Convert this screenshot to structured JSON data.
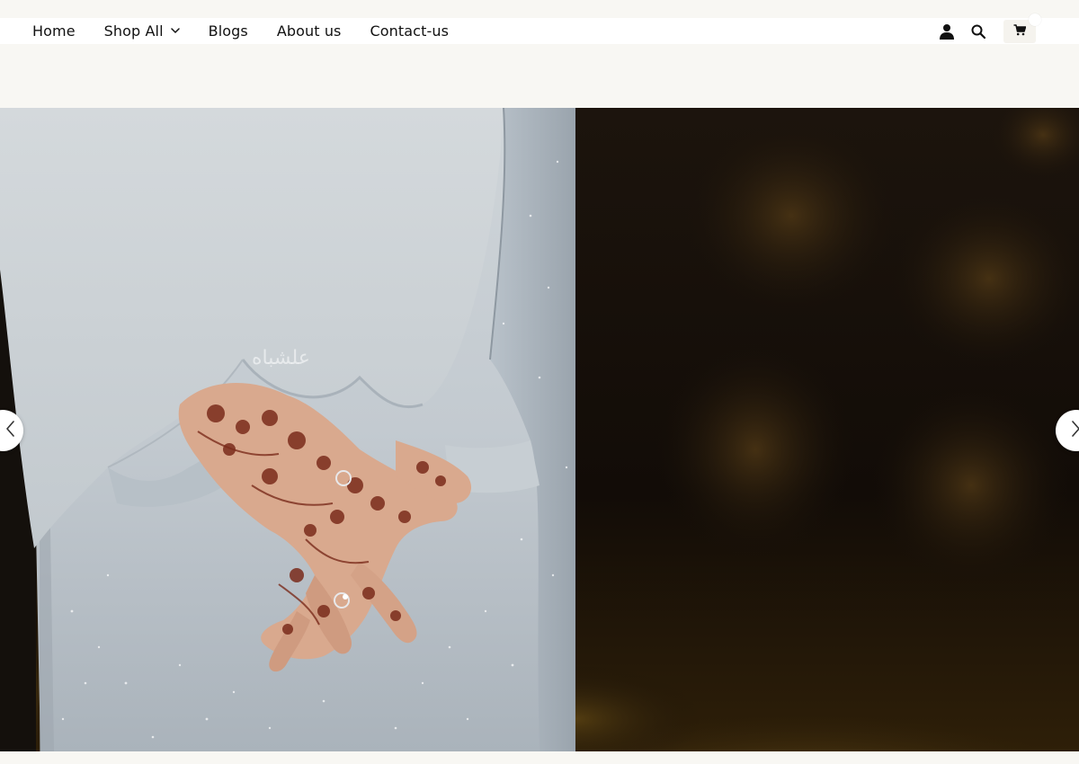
{
  "nav": {
    "items": [
      {
        "label": "Home"
      },
      {
        "label": "Shop All",
        "has_dropdown": true
      },
      {
        "label": "Blogs"
      },
      {
        "label": "About us"
      },
      {
        "label": "Contact-us"
      }
    ],
    "icons": [
      "account-icon",
      "search-icon",
      "cart-icon"
    ]
  },
  "hero": {
    "watermark": "علشباه",
    "prev_icon": "chevron-left-icon",
    "next_icon": "chevron-right-icon"
  },
  "colors": {
    "page_bg": "#f8f7f3",
    "nav_bg": "#ffffff",
    "text": "#111111",
    "hero_dark": "#150f0a",
    "gown": "#c9d0d6"
  }
}
